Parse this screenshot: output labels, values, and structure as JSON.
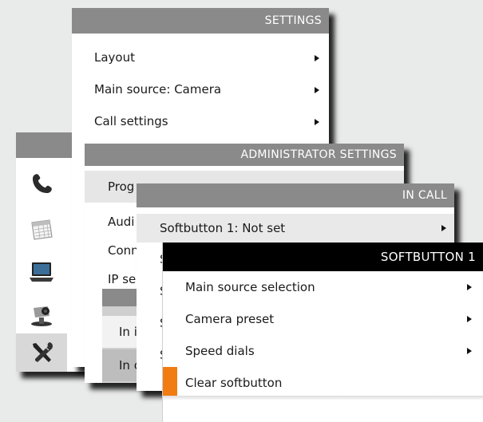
{
  "settings_menu": {
    "title": "SETTINGS",
    "items": [
      {
        "label": "Layout"
      },
      {
        "label": "Main source: Camera"
      },
      {
        "label": "Call settings"
      }
    ]
  },
  "admin_menu": {
    "title": "ADMINISTRATOR SETTINGS",
    "items": [
      {
        "label": "Prog"
      },
      {
        "label": "Audi"
      },
      {
        "label": "Conn"
      },
      {
        "label": "IP se"
      }
    ],
    "submenu_items": [
      "In i",
      "In c"
    ]
  },
  "incall_menu": {
    "title": "IN CALL",
    "first_item": "Softbutton  1: Not set",
    "partial_labels": [
      "S",
      "S",
      "S",
      "S"
    ]
  },
  "softbutton_menu": {
    "title": "SOFTBUTTON 1",
    "items": [
      {
        "label": "Main source selection",
        "has_submenu": true
      },
      {
        "label": "Camera preset",
        "has_submenu": true
      },
      {
        "label": "Speed dials",
        "has_submenu": true
      },
      {
        "label": "Clear softbutton",
        "has_submenu": false,
        "selected": true
      }
    ]
  },
  "home_icons": [
    "phone-icon",
    "calendar-icon",
    "laptop-icon",
    "camera-icon",
    "tools-icon"
  ],
  "colors": {
    "accent": "#f07c12",
    "header": "#8a8a8a",
    "active_header": "#000000",
    "background": "#e9eaea"
  }
}
